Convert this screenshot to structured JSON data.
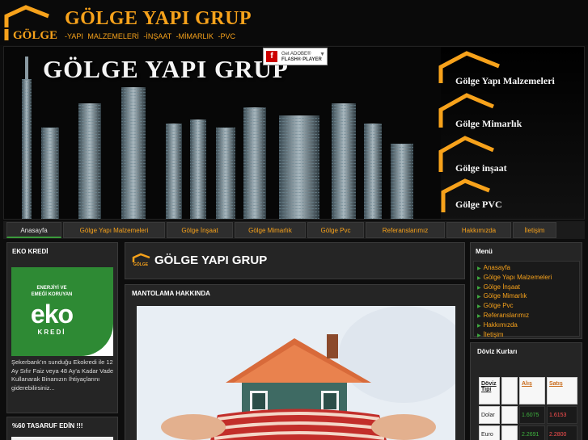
{
  "header": {
    "logo_text": "GÖLGE",
    "title": "GÖLGE YAPI GRUP",
    "subtitle": "-YAPI MALZEMELERİ  -İNŞAAT  -MİMARLIK  -PVC"
  },
  "banner": {
    "title": "GÖLGE YAPI GRUP",
    "links": [
      "Gölge Yapı Malzemeleri",
      "Gölge Mimarlık",
      "Gölge inşaat",
      "Gölge PVC"
    ],
    "flash": {
      "line1": "Get ADOBE®",
      "line2": "FLASH® PLAYER",
      "icon": "f"
    }
  },
  "nav": {
    "items": [
      "Anasayfa",
      "Gölge Yapı Malzemeleri",
      "Gölge İnşaat",
      "Gölge Mimarlık",
      "Gölge Pvc",
      "Referanslarımız",
      "Hakkımızda",
      "İletişim"
    ],
    "active_index": 0
  },
  "left": {
    "eko_title": "EKO KREDİ",
    "eko_img": {
      "line1": "ENERJİYİ VE",
      "line2": "EMEĞİ KORUYAN",
      "brand": "eko",
      "sub": "KREDİ"
    },
    "eko_desc": "Şekerbank'ın sunduğu Ekokredi ile 12 Ay Sıfır Faiz veya 48 Ay'a Kadar Vade Kullanarak Binanızın İhtiyaçlarını giderebilirsiniz...",
    "saving_title": "%60 TASARUF EDİN !!!"
  },
  "center": {
    "head_title": "GÖLGE YAPI GRUP",
    "mini_logo": "GÖLGE",
    "article_title": "MANTOLAMA HAKKINDA"
  },
  "right": {
    "menu_title": "Menü",
    "menu_items": [
      "Anasayfa",
      "Gölge Yapı Malzemeleri",
      "Gölge İnşaat",
      "Gölge Mimarlık",
      "Gölge Pvc",
      "Referanslarımız",
      "Hakkımızda",
      "İletişim"
    ],
    "fx_title": "Döviz Kurları",
    "fx_headers": [
      "Döviz Tipi",
      "",
      "Alış",
      "Satış"
    ],
    "fx_rows": [
      {
        "type": "Dolar",
        "buy": "1.6075",
        "sell": "1.6153"
      },
      {
        "type": "Euro",
        "buy": "2.2691",
        "sell": "2.2800"
      }
    ]
  },
  "colors": {
    "accent": "#f7a21b",
    "green": "#3fa83f",
    "panel": "#252525",
    "background": "#0d0d0d"
  }
}
